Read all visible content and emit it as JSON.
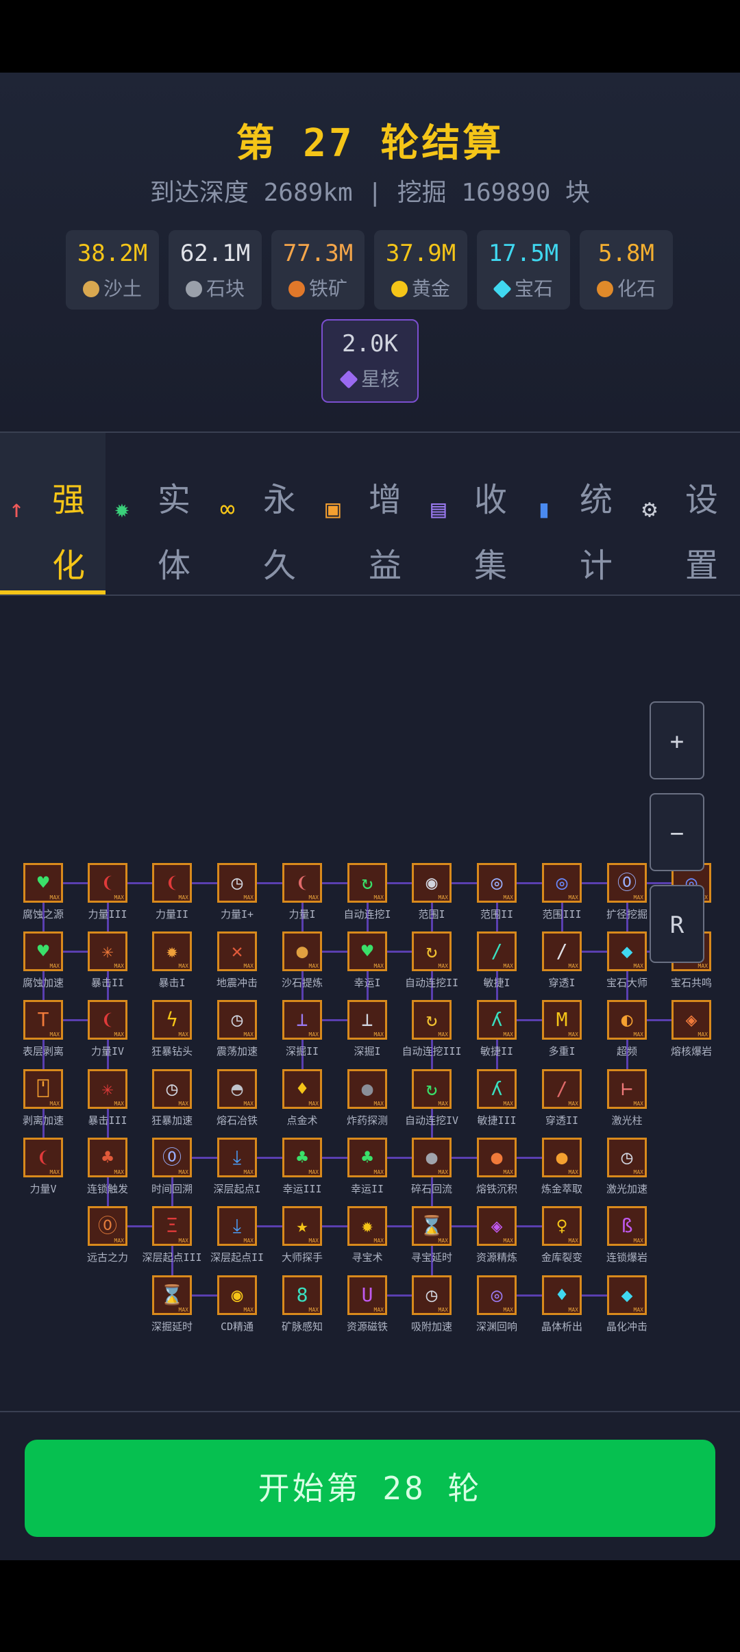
{
  "title": "第 27 轮结算",
  "subtitle": "到达深度 2689km | 挖掘 169890 块",
  "resources": [
    {
      "value": "38.2M",
      "label": "沙土",
      "color": "#f5c518",
      "icon": "sand-icon",
      "icon_color": "#d9a850"
    },
    {
      "value": "62.1M",
      "label": "石块",
      "color": "#e0e2e8",
      "icon": "stone-icon",
      "icon_color": "#9aa0aa"
    },
    {
      "value": "77.3M",
      "label": "铁矿",
      "color": "#f5a64a",
      "icon": "iron-ore-icon",
      "icon_color": "#e0782a"
    },
    {
      "value": "37.9M",
      "label": "黄金",
      "color": "#f5c518",
      "icon": "gold-icon",
      "icon_color": "#f5c518"
    },
    {
      "value": "17.5M",
      "label": "宝石",
      "color": "#40d8f0",
      "icon": "gem-icon",
      "icon_color": "#40d8f0"
    },
    {
      "value": "5.8M",
      "label": "化石",
      "color": "#f5b030",
      "icon": "fossil-icon",
      "icon_color": "#e08a2a"
    },
    {
      "value": "2.0K",
      "label": "星核",
      "color": "#d0d4de",
      "icon": "star-core-icon",
      "icon_color": "#9a6af0"
    }
  ],
  "tabs": [
    {
      "label": "强化",
      "icon": "↑",
      "icon_color": "#f05a5a",
      "active": true
    },
    {
      "label": "实体",
      "icon": "✹",
      "icon_color": "#3ad07a",
      "active": false
    },
    {
      "label": "永久",
      "icon": "∞",
      "icon_color": "#f5c518",
      "active": false
    },
    {
      "label": "增益",
      "icon": "▣",
      "icon_color": "#f5a030",
      "active": false
    },
    {
      "label": "收集",
      "icon": "▤",
      "icon_color": "#9a7af0",
      "active": false
    },
    {
      "label": "统计",
      "icon": "▮",
      "icon_color": "#4a8af0",
      "active": false
    },
    {
      "label": "设置",
      "icon": "⚙",
      "icon_color": "#c8ccd6",
      "active": false
    }
  ],
  "zoom": {
    "plus": "+",
    "minus": "−",
    "reset": "R"
  },
  "nodes": [
    {
      "label": "腐蚀之源",
      "glyph": "♥",
      "color": "#3ae06a"
    },
    {
      "label": "力量III",
      "glyph": "❨",
      "color": "#e03a3a"
    },
    {
      "label": "力量II",
      "glyph": "❨",
      "color": "#e03a3a"
    },
    {
      "label": "力量I+",
      "glyph": "◷",
      "color": "#d0d4de"
    },
    {
      "label": "力量I",
      "glyph": "❨",
      "color": "#e06a6a"
    },
    {
      "label": "自动连挖I",
      "glyph": "↻",
      "color": "#3ae06a"
    },
    {
      "label": "范围I",
      "glyph": "◉",
      "color": "#d0d4de"
    },
    {
      "label": "范围II",
      "glyph": "◎",
      "color": "#9ab0ff"
    },
    {
      "label": "范围III",
      "glyph": "◎",
      "color": "#6a8aff"
    },
    {
      "label": "扩径挖掘",
      "glyph": "⓪",
      "color": "#9ab0ff"
    },
    {
      "label": "",
      "glyph": "◎",
      "color": "#6a8aff"
    },
    {
      "label": "腐蚀加速",
      "glyph": "♥",
      "color": "#3ae06a"
    },
    {
      "label": "暴击II",
      "glyph": "✳",
      "color": "#f07a3a"
    },
    {
      "label": "暴击I",
      "glyph": "✹",
      "color": "#f0a03a"
    },
    {
      "label": "地震冲击",
      "glyph": "✕",
      "color": "#e05a3a"
    },
    {
      "label": "沙石提炼",
      "glyph": "●",
      "color": "#e0a040"
    },
    {
      "label": "幸运I",
      "glyph": "♥",
      "color": "#3ae06a"
    },
    {
      "label": "自动连挖II",
      "glyph": "↻",
      "color": "#f0c030"
    },
    {
      "label": "敏捷I",
      "glyph": "/",
      "color": "#3ae0c0"
    },
    {
      "label": "穿透I",
      "glyph": "/",
      "color": "#e0e2e8"
    },
    {
      "label": "宝石大师",
      "glyph": "◆",
      "color": "#40d8f0"
    },
    {
      "label": "宝石共鸣",
      "glyph": "◆",
      "color": "#40a8c0"
    },
    {
      "label": "表层剥离",
      "glyph": "T",
      "color": "#f07a3a"
    },
    {
      "label": "力量IV",
      "glyph": "❨",
      "color": "#e03a3a"
    },
    {
      "label": "狂暴钻头",
      "glyph": "ϟ",
      "color": "#f5c518"
    },
    {
      "label": "震荡加速",
      "glyph": "◷",
      "color": "#d0d4de"
    },
    {
      "label": "深掘II",
      "glyph": "⊥",
      "color": "#9a7af0"
    },
    {
      "label": "深掘I",
      "glyph": "⊥",
      "color": "#d0d4de"
    },
    {
      "label": "自动连挖III",
      "glyph": "↻",
      "color": "#f0c030"
    },
    {
      "label": "敏捷II",
      "glyph": "ʎ",
      "color": "#3ae0c0"
    },
    {
      "label": "多重I",
      "glyph": "M",
      "color": "#f5c518"
    },
    {
      "label": "超频",
      "glyph": "◐",
      "color": "#f5a030"
    },
    {
      "label": "熔核爆岩",
      "glyph": "◈",
      "color": "#f07a3a"
    },
    {
      "label": "剥离加速",
      "glyph": "⍞",
      "color": "#f5a030"
    },
    {
      "label": "暴击III",
      "glyph": "✳",
      "color": "#e03a3a"
    },
    {
      "label": "狂暴加速",
      "glyph": "◷",
      "color": "#d0d4de"
    },
    {
      "label": "熔石冶铁",
      "glyph": "◓",
      "color": "#c0c4cc"
    },
    {
      "label": "点金术",
      "glyph": "♦",
      "color": "#f5c518"
    },
    {
      "label": "炸药探测",
      "glyph": "●",
      "color": "#8a8f98"
    },
    {
      "label": "自动连挖IV",
      "glyph": "↻",
      "color": "#3ae06a"
    },
    {
      "label": "敏捷III",
      "glyph": "ʎ",
      "color": "#3ae0c0"
    },
    {
      "label": "穿透II",
      "glyph": "/",
      "color": "#e06a6a"
    },
    {
      "label": "激光柱",
      "glyph": "⊢",
      "color": "#f07a7a"
    },
    {
      "label": "力量V",
      "glyph": "❨",
      "color": "#e03a3a"
    },
    {
      "label": "连锁触发",
      "glyph": "♣",
      "color": "#e05a3a"
    },
    {
      "label": "时间回溯",
      "glyph": "⓪",
      "color": "#9ab0ff"
    },
    {
      "label": "深层起点I",
      "glyph": "⤓",
      "color": "#4a9af0"
    },
    {
      "label": "幸运III",
      "glyph": "♣",
      "color": "#3ae06a"
    },
    {
      "label": "幸运II",
      "glyph": "♣",
      "color": "#3ae06a"
    },
    {
      "label": "碎石回流",
      "glyph": "●",
      "color": "#a0a4ac"
    },
    {
      "label": "熔铁沉积",
      "glyph": "●",
      "color": "#f07a3a"
    },
    {
      "label": "炼金萃取",
      "glyph": "●",
      "color": "#f5a030"
    },
    {
      "label": "激光加速",
      "glyph": "◷",
      "color": "#d0d4de"
    },
    {
      "label": "远古之力",
      "glyph": "⓪",
      "color": "#e07a3a"
    },
    {
      "label": "深层起点III",
      "glyph": "Ξ",
      "color": "#e03a3a"
    },
    {
      "label": "深层起点II",
      "glyph": "⤓",
      "color": "#4a9af0"
    },
    {
      "label": "大师探手",
      "glyph": "★",
      "color": "#f5c518"
    },
    {
      "label": "寻宝术",
      "glyph": "✹",
      "color": "#f5c518"
    },
    {
      "label": "寻宝延时",
      "glyph": "⌛",
      "color": "#f5c518"
    },
    {
      "label": "资源精炼",
      "glyph": "◈",
      "color": "#c05af0"
    },
    {
      "label": "金库裂变",
      "glyph": "♀",
      "color": "#f5c518"
    },
    {
      "label": "连锁爆岩",
      "glyph": "ß",
      "color": "#c05af0"
    },
    {
      "label": "深掘延时",
      "glyph": "⌛",
      "color": "#9ab0ff"
    },
    {
      "label": "CD精通",
      "glyph": "◉",
      "color": "#f5c518"
    },
    {
      "label": "矿脉感知",
      "glyph": "8",
      "color": "#3ae0c0"
    },
    {
      "label": "资源磁铁",
      "glyph": "U",
      "color": "#c05af0"
    },
    {
      "label": "吸附加速",
      "glyph": "◷",
      "color": "#d0d4de"
    },
    {
      "label": "深渊回响",
      "glyph": "◎",
      "color": "#9a7af0"
    },
    {
      "label": "晶体析出",
      "glyph": "♦",
      "color": "#40d8f0"
    },
    {
      "label": "晶化冲击",
      "glyph": "◆",
      "color": "#40d8f0"
    }
  ],
  "node_badge": "MAX",
  "start_button": "开始第 28 轮"
}
